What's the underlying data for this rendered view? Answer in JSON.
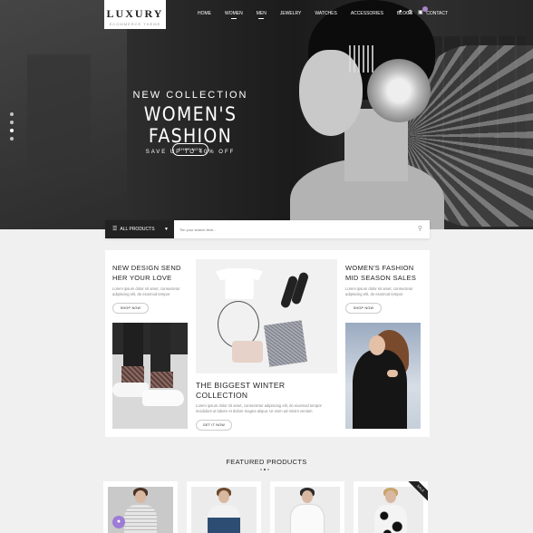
{
  "logo": {
    "name": "LUXURY",
    "tagline": "ECOMMERCE THEME"
  },
  "nav": {
    "items": [
      "HOME",
      "WOMEN",
      "MEN",
      "JEWELRY",
      "WATCHES",
      "ACCESSORIES",
      "BLOGS",
      "CONTACT"
    ],
    "icons": [
      "user-icon",
      "gear-icon",
      "cart-icon"
    ]
  },
  "hero": {
    "eyebrow": "NEW COLLECTION",
    "title": "WOMEN'S FASHION",
    "subtitle": "SAVE UP TO 40% OFF",
    "button": "SHOP NOW"
  },
  "search": {
    "category": "ALL PRODUCTS",
    "placeholder": "Tim your search item..."
  },
  "promo": {
    "left": {
      "title": "NEW DESIGN SEND HER YOUR LOVE",
      "text": "Lorem ipsum dolor sit amet, consectetur adipiscing elit, do eiusmod tempor",
      "button": "SHOP NOW"
    },
    "center": {
      "title": "THE BIGGEST WINTER COLLECTION",
      "text": "Lorem ipsum dolor sit amet, consectetur adipiscing elit, do eiusmod tempor incididunt ut labore et dolore magna aliqua. Ut enim ad minim veniam",
      "button": "GET IT NOW"
    },
    "right": {
      "title": "WOMEN'S FASHION MID SEASON SALES",
      "text": "Lorem ipsum dolor sit amet, consectetur adipiscing elit, do eiusmod tempor",
      "button": "SHOP NOW"
    }
  },
  "featured": {
    "title": "FEATURED PRODUCTS",
    "badge": "SALE"
  },
  "colors": {
    "accent": "#9d7bd6",
    "dark": "#222222",
    "background": "#f0f0f0"
  }
}
